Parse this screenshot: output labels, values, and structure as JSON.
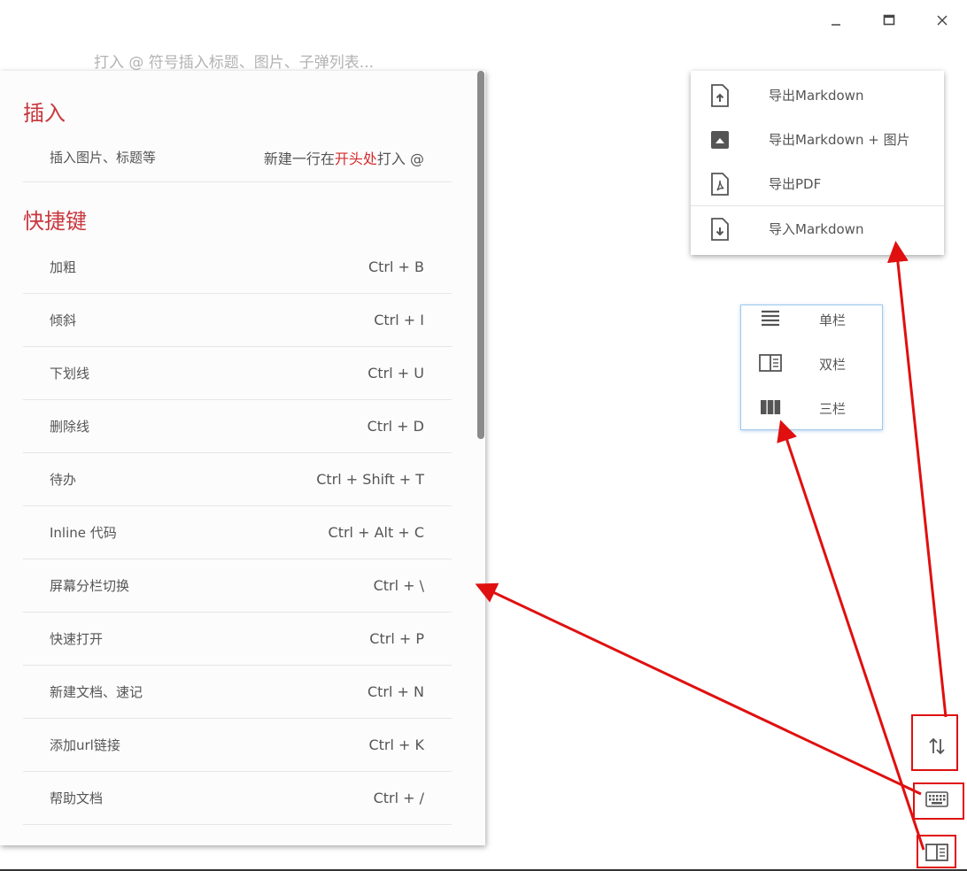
{
  "window": {
    "controls": [
      "minimize-icon",
      "maximize-icon",
      "close-icon"
    ]
  },
  "editor": {
    "placeholder": "打入 @ 符号插入标题、图片、子弹列表..."
  },
  "help": {
    "insert_title": "插入",
    "insert_row": {
      "label": "插入图片、标题等",
      "hint_prefix": "新建一行在",
      "hint_highlight": "开头处",
      "hint_suffix": "打入 @"
    },
    "shortcut_title": "快捷键",
    "shortcuts": [
      {
        "label": "加粗",
        "key": "Ctrl + B"
      },
      {
        "label": "倾斜",
        "key": "Ctrl + I"
      },
      {
        "label": "下划线",
        "key": "Ctrl + U"
      },
      {
        "label": "删除线",
        "key": "Ctrl + D"
      },
      {
        "label": "待办",
        "key": "Ctrl + Shift + T"
      },
      {
        "label": "Inline 代码",
        "key": "Ctrl + Alt + C"
      },
      {
        "label": "屏幕分栏切换",
        "key": "Ctrl + \\"
      },
      {
        "label": "快速打开",
        "key": "Ctrl + P"
      },
      {
        "label": "新建文档、速记",
        "key": "Ctrl + N"
      },
      {
        "label": "添加url链接",
        "key": "Ctrl + K"
      },
      {
        "label": "帮助文档",
        "key": "Ctrl + /"
      }
    ]
  },
  "export_menu": {
    "items": [
      {
        "label": "导出Markdown",
        "icon": "file-upload-icon"
      },
      {
        "label": "导出Markdown + 图片",
        "icon": "image-upload-icon"
      },
      {
        "label": "导出PDF",
        "icon": "pdf-file-icon"
      },
      {
        "label": "导入Markdown",
        "icon": "file-download-icon"
      }
    ]
  },
  "column_menu": {
    "items": [
      {
        "label": "单栏",
        "icon": "single-column-icon"
      },
      {
        "label": "双栏",
        "icon": "double-column-icon"
      },
      {
        "label": "三栏",
        "icon": "triple-column-icon"
      }
    ]
  },
  "floating_buttons": [
    "sort-icon",
    "keyboard-icon",
    "layout-icon"
  ],
  "colors": {
    "accent": "#c8373e",
    "annotation": "#e01010",
    "column_menu_border": "#9cc8ee"
  }
}
